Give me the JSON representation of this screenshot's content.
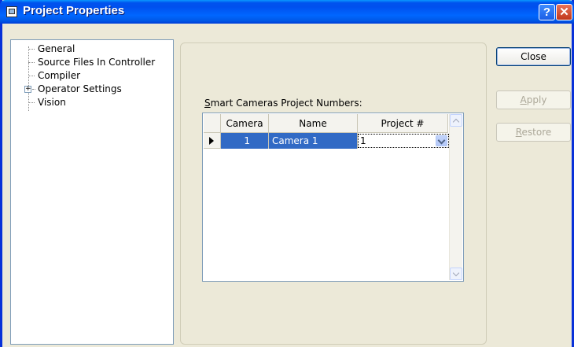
{
  "window": {
    "title": "Project Properties",
    "help_symbol": "?",
    "close_symbol": "✕"
  },
  "tree": {
    "items": [
      {
        "label": "General",
        "expandable": false
      },
      {
        "label": "Source Files In Controller",
        "expandable": false
      },
      {
        "label": "Compiler",
        "expandable": false
      },
      {
        "label": "Operator Settings",
        "expandable": true,
        "expander": "+"
      },
      {
        "label": "Vision",
        "expandable": false
      }
    ]
  },
  "grid": {
    "label_mnemonic": "S",
    "label_rest": "mart Cameras Project Numbers:",
    "columns": [
      "Camera #",
      "Name",
      "Project #"
    ],
    "rows": [
      {
        "camera": "1",
        "name": "Camera 1",
        "project": "1",
        "selected": true
      }
    ]
  },
  "buttons": {
    "close": {
      "label": "Close",
      "enabled": true
    },
    "apply": {
      "mnemonic": "A",
      "rest": "pply",
      "enabled": false
    },
    "restore": {
      "mnemonic": "R",
      "rest": "estore",
      "enabled": false
    }
  }
}
